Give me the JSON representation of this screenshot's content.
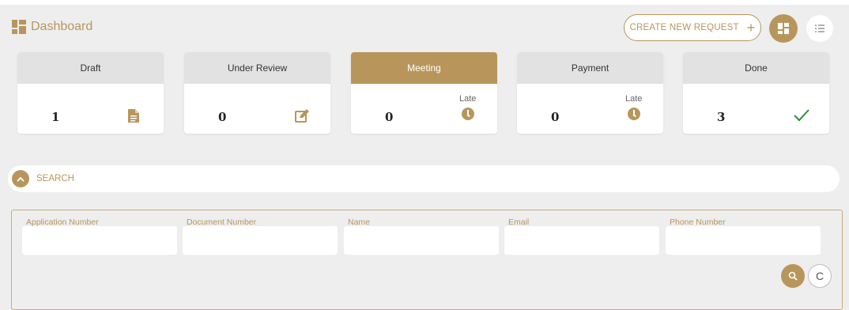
{
  "header": {
    "title": "Dashboard",
    "create_label": "CREATE NEW REQUEST",
    "create_icon": "+"
  },
  "cards": [
    {
      "label": "Draft",
      "count": "1",
      "icon": "document-icon"
    },
    {
      "label": "Under Review",
      "count": "0",
      "icon": "edit-icon"
    },
    {
      "label": "Meeting",
      "count": "0",
      "late": "Late",
      "icon": "clock-icon",
      "active": true
    },
    {
      "label": "Payment",
      "count": "0",
      "late": "Late",
      "icon": "clock-icon"
    },
    {
      "label": "Done",
      "count": "3",
      "icon": "check-icon"
    }
  ],
  "search": {
    "toggle_label": "SEARCH",
    "fields": [
      {
        "label": "Application Number",
        "value": ""
      },
      {
        "label": "Document Number",
        "value": ""
      },
      {
        "label": "Name",
        "value": ""
      },
      {
        "label": "Email",
        "value": ""
      },
      {
        "label": "Phone Number",
        "value": ""
      }
    ],
    "reset_icon": "C"
  },
  "colors": {
    "accent": "#b8965b",
    "card_header": "#e2e2e2",
    "background": "#eeeeee",
    "done_check": "#2e8b3a"
  }
}
